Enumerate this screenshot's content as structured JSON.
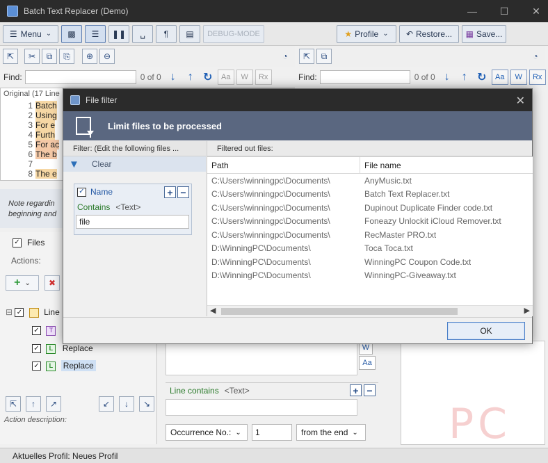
{
  "window": {
    "title": "Batch Text Replacer (Demo)"
  },
  "toolbar": {
    "menu_label": "Menu",
    "debug_label": "DEBUG-MODE",
    "profile_label": "Profile",
    "restore_label": "Restore...",
    "save_label": "Save..."
  },
  "find_left": {
    "label": "Find:",
    "count": "0 of 0",
    "opt_case": "Aa",
    "opt_word": "W",
    "opt_regex": "Rx"
  },
  "find_right": {
    "label": "Find:",
    "count": "0 of 0",
    "opt_case": "Aa",
    "opt_word": "W",
    "opt_regex": "Rx"
  },
  "original": {
    "header": "Original (17 Line",
    "lines": [
      {
        "n": "1",
        "text": "Batch"
      },
      {
        "n": "2",
        "text": "Using"
      },
      {
        "n": "3",
        "text": "For e"
      },
      {
        "n": "4",
        "text": "Furth"
      },
      {
        "n": "5",
        "text": "For ac"
      },
      {
        "n": "6",
        "text": "The b"
      },
      {
        "n": "7",
        "text": ""
      },
      {
        "n": "8",
        "text": "The e"
      }
    ]
  },
  "note": {
    "line1": "Note regardin",
    "line2": "beginning and"
  },
  "lower": {
    "files_tab": "Files",
    "actions_label": "Actions:",
    "tree": [
      "Line",
      "Replace",
      "Replace"
    ],
    "action_description": "Action description:",
    "line_contains": "Line contains",
    "text_token": "<Text>",
    "occurrence_label": "Occurrence No.:",
    "occurrence_value": "1",
    "from_end": "from the end",
    "aa_label": "Aa",
    "w_label": "W"
  },
  "status": {
    "profile": "Aktuelles Profil: Neues Profil"
  },
  "dialog": {
    "title": "File filter",
    "header": "Limit files to be processed",
    "filter_label": "Filter: (Edit the following files ...",
    "clear_label": "Clear",
    "name_label": "Name",
    "contains_label": "Contains",
    "text_token": "<Text>",
    "filter_value": "file",
    "filtered_label": "Filtered out files:",
    "col_path": "Path",
    "col_filename": "File name",
    "rows": [
      {
        "path": "C:\\Users\\winningpc\\Documents\\",
        "name": "AnyMusic.txt"
      },
      {
        "path": "C:\\Users\\winningpc\\Documents\\",
        "name": "Batch Text Replacer.txt"
      },
      {
        "path": "C:\\Users\\winningpc\\Documents\\",
        "name": "Dupinout Duplicate Finder code.txt"
      },
      {
        "path": "C:\\Users\\winningpc\\Documents\\",
        "name": "Foneazy Unlockit iCloud Remover.txt"
      },
      {
        "path": "C:\\Users\\winningpc\\Documents\\",
        "name": "RecMaster PRO.txt"
      },
      {
        "path": "D:\\WinningPC\\Documents\\",
        "name": "Toca Toca.txt"
      },
      {
        "path": "D:\\WinningPC\\Documents\\",
        "name": "WinningPC Coupon Code.txt"
      },
      {
        "path": "D:\\WinningPC\\Documents\\",
        "name": "WinningPC-Giveaway.txt"
      }
    ],
    "ok_label": "OK"
  },
  "colors": {
    "accent": "#1f5fb5",
    "dialog_header": "#5a6780",
    "titlebar": "#2b2b2b"
  }
}
